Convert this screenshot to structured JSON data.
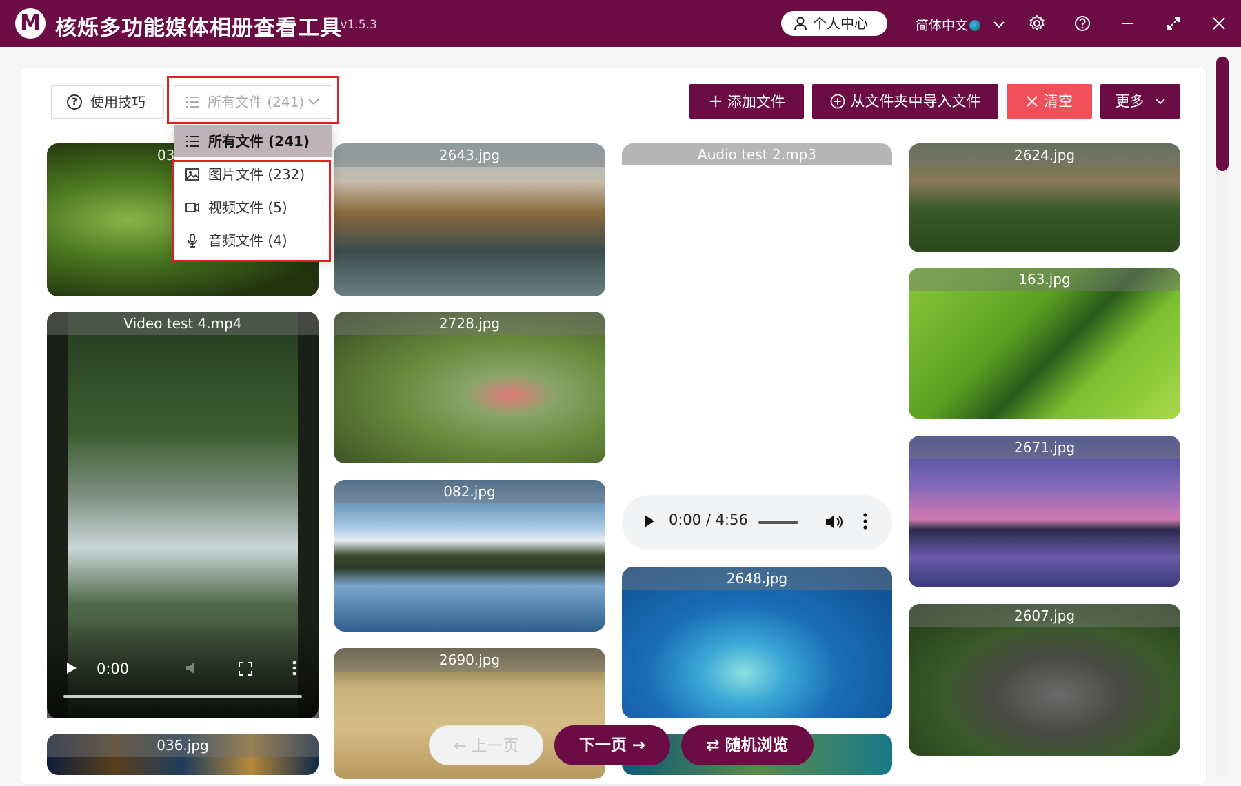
{
  "app": {
    "logo_letter": "M",
    "title": "核烁多功能媒体相册查看工具",
    "version": "- v1.5.3",
    "user_center": "个人中心",
    "language": "简体中文"
  },
  "toolbar": {
    "tips": "使用技巧",
    "filter_value": "所有文件 (241)",
    "add_files": "添加文件",
    "import_folder": "从文件夹中导入文件",
    "clear": "清空",
    "more": "更多"
  },
  "filter_menu": [
    {
      "label": "所有文件 (241)",
      "icon": "list-icon",
      "selected": true
    },
    {
      "label": "图片文件 (232)",
      "icon": "image-icon",
      "selected": false
    },
    {
      "label": "视频文件 (5)",
      "icon": "video-icon",
      "selected": false
    },
    {
      "label": "音频文件 (4)",
      "icon": "microphone-icon",
      "selected": false
    }
  ],
  "media": {
    "col1": [
      "03",
      "Video test 4.mp4",
      "036.jpg"
    ],
    "col2": [
      "2643.jpg",
      "2728.jpg",
      "082.jpg",
      "2690.jpg"
    ],
    "col3": [
      "Audio test 2.mp3",
      "2648.jpg"
    ],
    "col4": [
      "2624.jpg",
      "163.jpg",
      "2671.jpg",
      "2607.jpg"
    ]
  },
  "video_player": {
    "time": "0:00"
  },
  "audio_player": {
    "time": "0:00 / 4:56"
  },
  "pager": {
    "prev": "上一页",
    "next": "下一页",
    "random": "随机浏览"
  },
  "colors": {
    "brand": "#6c0c45",
    "danger": "#f0505a",
    "highlight": "#e02020"
  }
}
